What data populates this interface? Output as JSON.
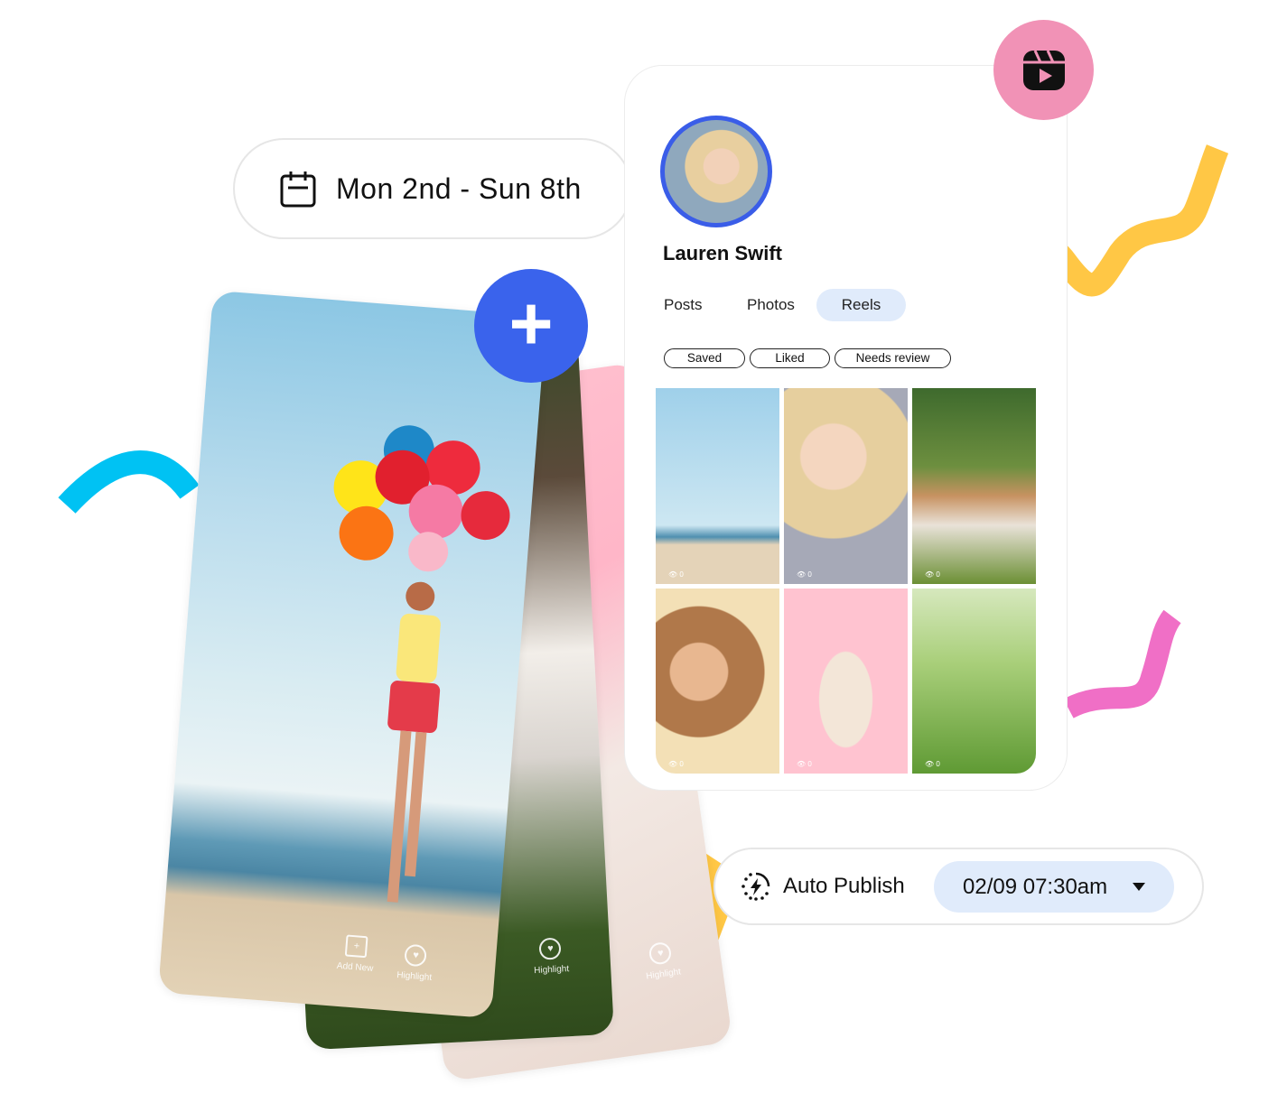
{
  "date_range": {
    "label": "Mon 2nd - Sun 8th",
    "icon": "calendar-icon"
  },
  "add_button": {
    "icon": "plus-icon",
    "color": "#3a63ec"
  },
  "phone_cards": {
    "front": {
      "actions": [
        {
          "label": "Add New",
          "icon": "add-media-icon"
        },
        {
          "label": "Highlight",
          "icon": "heart-icon"
        }
      ]
    },
    "middle": {
      "actions": [
        {
          "label": "Highlight",
          "icon": "heart-icon"
        }
      ]
    },
    "back": {
      "actions": [
        {
          "label": "Highlight",
          "icon": "heart-icon"
        }
      ]
    }
  },
  "profile": {
    "badge_icon": "reels-icon",
    "badge_color": "#f192b6",
    "name": "Lauren Swift",
    "tabs": [
      {
        "label": "Posts",
        "active": false
      },
      {
        "label": "Photos",
        "active": false
      },
      {
        "label": "Reels",
        "active": true
      }
    ],
    "filters": [
      "Saved",
      "Liked",
      "Needs review"
    ],
    "grid": [
      {
        "views": "0"
      },
      {
        "views": "0"
      },
      {
        "views": "0"
      },
      {
        "views": "0"
      },
      {
        "views": "0"
      },
      {
        "views": "0"
      }
    ]
  },
  "auto_publish": {
    "label": "Auto Publish",
    "icon": "auto-publish-icon",
    "datetime": "02/09 07:30am"
  },
  "colors": {
    "accent": "#3a63ec",
    "yellow": "#ffc745",
    "cyan": "#00c2f3",
    "pink": "#f06fc6",
    "tab_active": "#e0ebfb"
  }
}
